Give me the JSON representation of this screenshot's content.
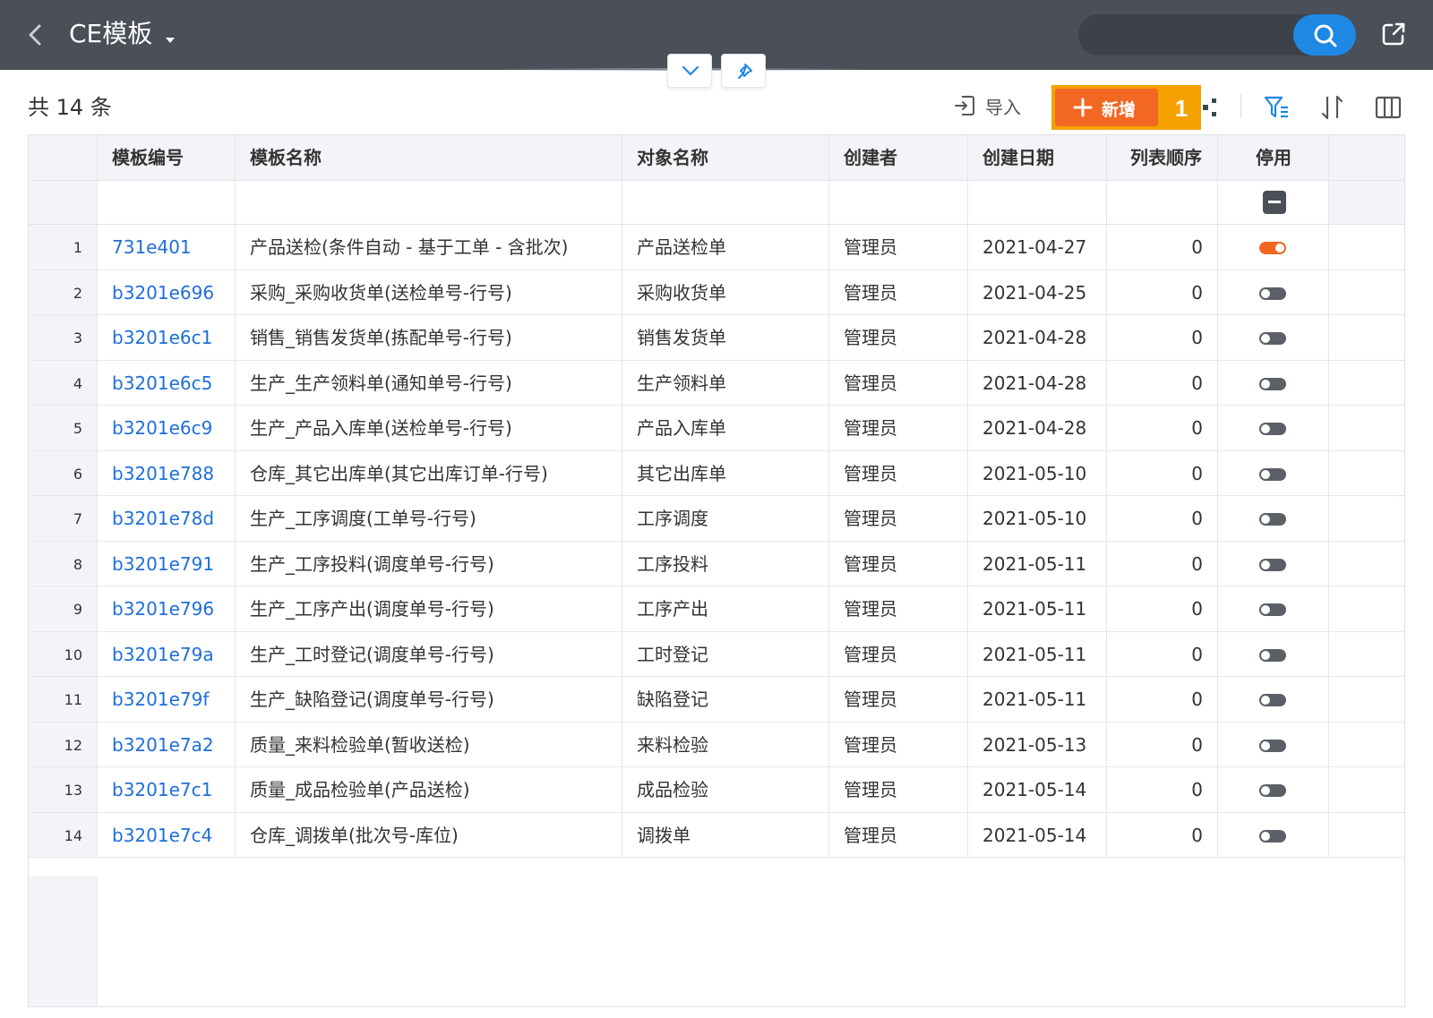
{
  "header": {
    "title": "CE模板",
    "search_placeholder": "",
    "colors": {
      "bar": "#4a4f58",
      "search_button": "#1e88e5"
    },
    "icons": [
      "back-arrow-icon",
      "caret-down-icon",
      "search-icon",
      "share-icon"
    ]
  },
  "toolbar": {
    "total_label": "共 14 条",
    "import_label": "导入",
    "add_label": "新增",
    "badge_number": "1",
    "colors": {
      "add_button": "#f26722",
      "highlight": "#f5a100"
    },
    "icons": [
      "import-icon",
      "plus-icon",
      "more-icon",
      "filter-icon",
      "sort-icon",
      "columns-icon",
      "chevron-down-icon",
      "pin-icon"
    ]
  },
  "table": {
    "columns": [
      "",
      "模板编号",
      "模板名称",
      "对象名称",
      "创建者",
      "创建日期",
      "列表顺序",
      "停用",
      ""
    ],
    "rows": [
      {
        "num": "1",
        "code": "731e401",
        "name": "产品送检(条件自动 - 基于工单 - 含批次)",
        "object": "产品送检单",
        "creator": "管理员",
        "date": "2021-04-27",
        "order": "0",
        "disabled": true
      },
      {
        "num": "2",
        "code": "b3201e696",
        "name": "采购_采购收货单(送检单号-行号)",
        "object": "采购收货单",
        "creator": "管理员",
        "date": "2021-04-25",
        "order": "0",
        "disabled": false
      },
      {
        "num": "3",
        "code": "b3201e6c1",
        "name": "销售_销售发货单(拣配单号-行号)",
        "object": "销售发货单",
        "creator": "管理员",
        "date": "2021-04-28",
        "order": "0",
        "disabled": false
      },
      {
        "num": "4",
        "code": "b3201e6c5",
        "name": "生产_生产领料单(通知单号-行号)",
        "object": "生产领料单",
        "creator": "管理员",
        "date": "2021-04-28",
        "order": "0",
        "disabled": false
      },
      {
        "num": "5",
        "code": "b3201e6c9",
        "name": "生产_产品入库单(送检单号-行号)",
        "object": "产品入库单",
        "creator": "管理员",
        "date": "2021-04-28",
        "order": "0",
        "disabled": false
      },
      {
        "num": "6",
        "code": "b3201e788",
        "name": "仓库_其它出库单(其它出库订单-行号)",
        "object": "其它出库单",
        "creator": "管理员",
        "date": "2021-05-10",
        "order": "0",
        "disabled": false
      },
      {
        "num": "7",
        "code": "b3201e78d",
        "name": "生产_工序调度(工单号-行号)",
        "object": "工序调度",
        "creator": "管理员",
        "date": "2021-05-10",
        "order": "0",
        "disabled": false
      },
      {
        "num": "8",
        "code": "b3201e791",
        "name": "生产_工序投料(调度单号-行号)",
        "object": "工序投料",
        "creator": "管理员",
        "date": "2021-05-11",
        "order": "0",
        "disabled": false
      },
      {
        "num": "9",
        "code": "b3201e796",
        "name": "生产_工序产出(调度单号-行号)",
        "object": "工序产出",
        "creator": "管理员",
        "date": "2021-05-11",
        "order": "0",
        "disabled": false
      },
      {
        "num": "10",
        "code": "b3201e79a",
        "name": "生产_工时登记(调度单号-行号)",
        "object": "工时登记",
        "creator": "管理员",
        "date": "2021-05-11",
        "order": "0",
        "disabled": false
      },
      {
        "num": "11",
        "code": "b3201e79f",
        "name": "生产_缺陷登记(调度单号-行号)",
        "object": "缺陷登记",
        "creator": "管理员",
        "date": "2021-05-11",
        "order": "0",
        "disabled": false
      },
      {
        "num": "12",
        "code": "b3201e7a2",
        "name": "质量_来料检验单(暂收送检)",
        "object": "来料检验",
        "creator": "管理员",
        "date": "2021-05-13",
        "order": "0",
        "disabled": false
      },
      {
        "num": "13",
        "code": "b3201e7c1",
        "name": "质量_成品检验单(产品送检)",
        "object": "成品检验",
        "creator": "管理员",
        "date": "2021-05-14",
        "order": "0",
        "disabled": false
      },
      {
        "num": "14",
        "code": "b3201e7c4",
        "name": "仓库_调拨单(批次号-库位)",
        "object": "调拨单",
        "creator": "管理员",
        "date": "2021-05-14",
        "order": "0",
        "disabled": false
      }
    ],
    "toggle_colors": {
      "on": "#f26722",
      "off": "#5b5f66"
    }
  }
}
